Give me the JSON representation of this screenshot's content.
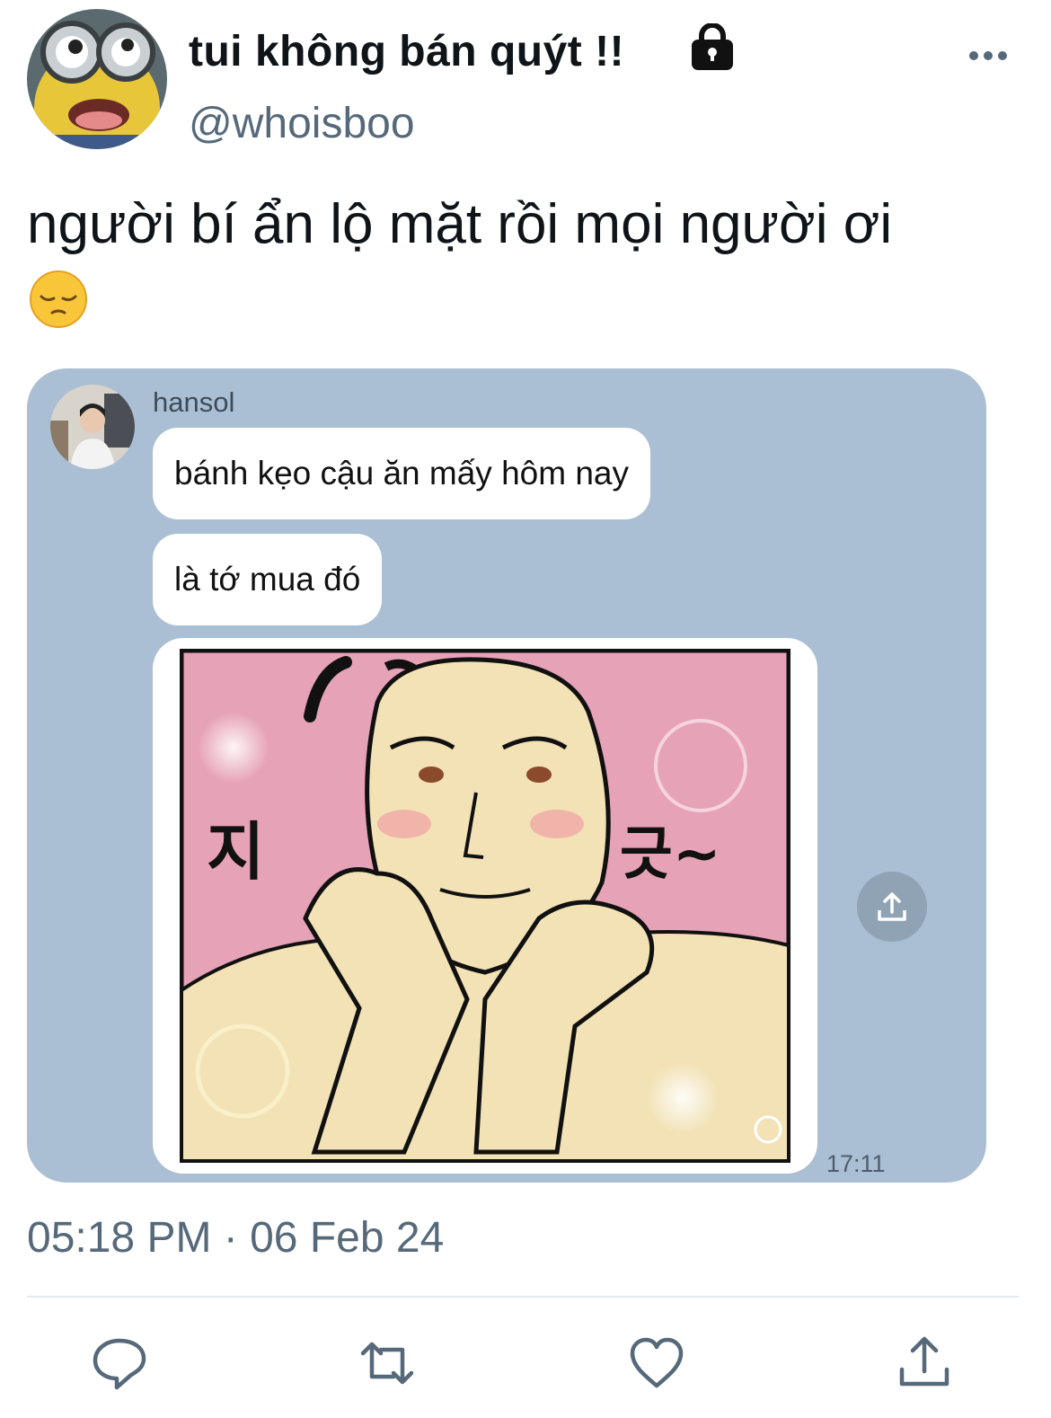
{
  "tweet": {
    "display_name": "tui không bán quýt !!",
    "handle": "@whoisboo",
    "text": "người bí ẩn lộ mặt rồi mọi người ơi",
    "emoji": "pensive-face",
    "timestamp": "05:18 PM · 06 Feb 24"
  },
  "chat": {
    "sender": "hansol",
    "messages": [
      "bánh kẹo cậu ăn mấy hôm nay",
      "là tớ mua đó"
    ],
    "sticker": {
      "text_left": "지",
      "text_right": "긋~"
    },
    "time": "17:11"
  },
  "actions": [
    "reply-icon",
    "retweet-icon",
    "like-icon",
    "share-icon"
  ],
  "colors": {
    "handle": "#56697a",
    "chat_bg": "#aabfd3",
    "sticker_pink": "#e6a2b6"
  }
}
